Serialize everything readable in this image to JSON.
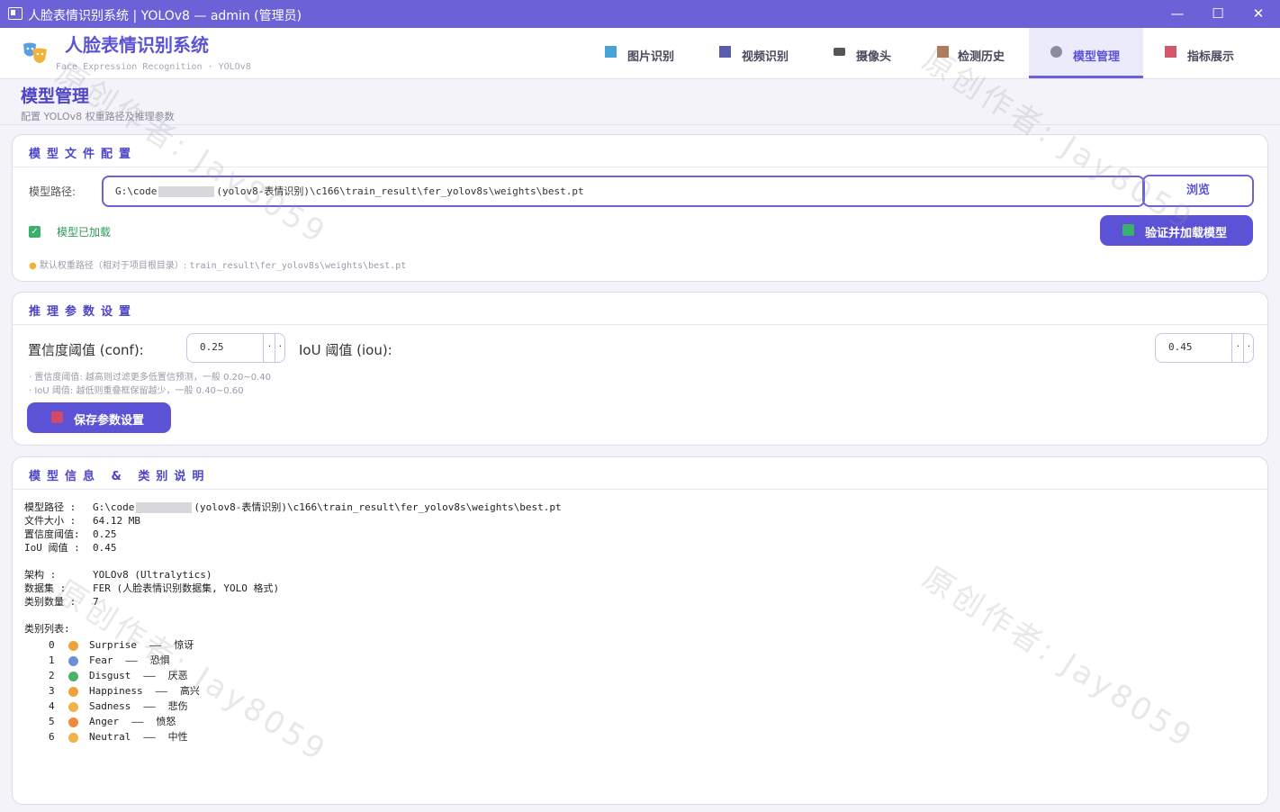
{
  "window": {
    "title": "人脸表情识别系统 | YOLOv8 — admin (管理员)",
    "minimize": "—",
    "maximize": "☐",
    "close": "✕"
  },
  "header": {
    "app_name": "人脸表情识别系统",
    "subtitle": "Face Expression Recognition  ·  YOLOv8",
    "tabs": [
      {
        "label": "图片识别",
        "icon": "image-icon",
        "color": "#4aa3d8"
      },
      {
        "label": "视频识别",
        "icon": "film-icon",
        "color": "#5a5ab0"
      },
      {
        "label": "摄像头",
        "icon": "camera-icon",
        "color": "#555"
      },
      {
        "label": "检测历史",
        "icon": "history-icon",
        "color": "#b07a5a"
      },
      {
        "label": "模型管理",
        "icon": "gear-icon",
        "color": "#8a8aa0"
      },
      {
        "label": "指标展示",
        "icon": "bar-chart-icon",
        "color": "#d05a6a"
      }
    ],
    "active_tab": "模型管理"
  },
  "page": {
    "title": "模型管理",
    "subtitle": "配置 YOLOv8 权重路径及推理参数"
  },
  "model_file": {
    "section_title": "模型文件配置",
    "path_label": "模型路径:",
    "path_prefix": "G:\\code",
    "path_suffix": "(yolov8-表情识别)\\c166\\train_result\\fer_yolov8s\\weights\\best.pt",
    "browse_label": "浏览",
    "status_label": "模型已加载",
    "verify_label": "验证并加载模型",
    "tip_prefix": "默认权重路径（相对于项目根目录）: ",
    "tip_path": "train_result\\fer_yolov8s\\weights\\best.pt"
  },
  "inference": {
    "section_title": "推理参数设置",
    "conf_label": "置信度阈值 (conf):",
    "conf_value": "0.25",
    "iou_label": "IoU 阈值 (iou):",
    "iou_value": "0.45",
    "hint_conf": "· 置信度阈值: 越高则过滤更多低置信预测，一般 0.20~0.40",
    "hint_iou": "· IoU 阈值: 越低则重叠框保留越少，一般 0.40~0.60",
    "save_label": "保存参数设置"
  },
  "model_info": {
    "section_title": "模型信息 & 类别说明",
    "path_key": "模型路径 :",
    "path_prefix": "G:\\code",
    "path_suffix": "(yolov8-表情识别)\\c166\\train_result\\fer_yolov8s\\weights\\best.pt",
    "size_key": "文件大小 :",
    "size_value": "64.12 MB",
    "conf_key": "置信度阈值:",
    "conf_value": "0.25",
    "iou_key": "IoU 阈值 :",
    "iou_value": "0.45",
    "arch_key": "架构     :",
    "arch_value": "YOLOv8 (Ultralytics)",
    "dataset_key": "数据集   :",
    "dataset_value": "FER (人脸表情识别数据集, YOLO 格式)",
    "count_key": "类别数量 :",
    "count_value": "7",
    "list_title": "类别列表:",
    "classes": [
      {
        "idx": "0",
        "en": "Surprise",
        "sep": "——",
        "zh": "惊讶",
        "emoji": "surprise-emoji-icon",
        "color": "#f2a23a"
      },
      {
        "idx": "1",
        "en": "Fear",
        "sep": "——",
        "zh": "恐惧",
        "emoji": "fear-emoji-icon",
        "color": "#6d8fd8"
      },
      {
        "idx": "2",
        "en": "Disgust",
        "sep": "——",
        "zh": "厌恶",
        "emoji": "disgust-emoji-icon",
        "color": "#4fb06a"
      },
      {
        "idx": "3",
        "en": "Happiness",
        "sep": "——",
        "zh": "高兴",
        "emoji": "happy-emoji-icon",
        "color": "#f2a23a"
      },
      {
        "idx": "4",
        "en": "Sadness",
        "sep": "——",
        "zh": "悲伤",
        "emoji": "sad-emoji-icon",
        "color": "#f2b24a"
      },
      {
        "idx": "5",
        "en": "Anger",
        "sep": "——",
        "zh": "愤怒",
        "emoji": "angry-emoji-icon",
        "color": "#f08a3a"
      },
      {
        "idx": "6",
        "en": "Neutral",
        "sep": "——",
        "zh": "中性",
        "emoji": "neutral-emoji-icon",
        "color": "#f2b24a"
      }
    ]
  },
  "watermark": "原创作者: Jay8059",
  "colors": {
    "accent": "#6a62d6",
    "success": "#3ab06a"
  }
}
